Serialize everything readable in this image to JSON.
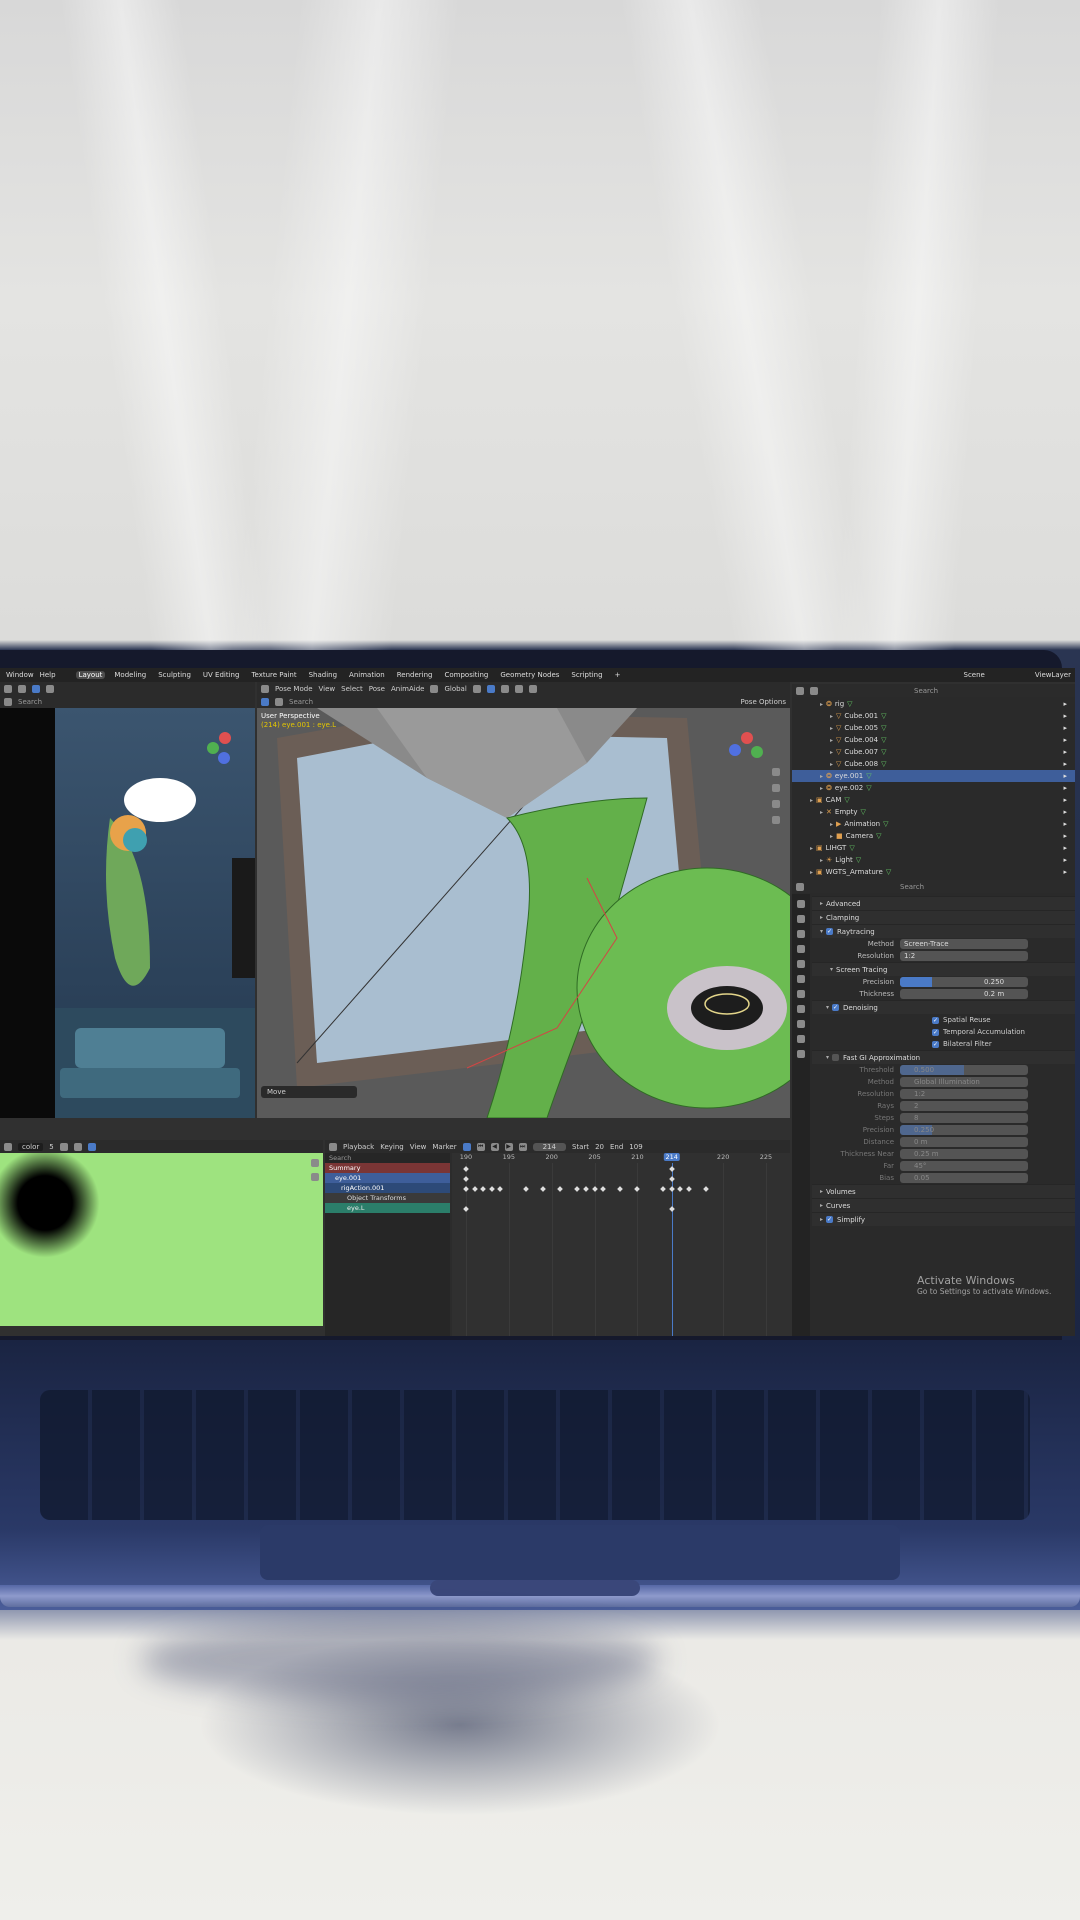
{
  "menu": {
    "items": [
      "Window",
      "Help"
    ],
    "workspaces": [
      "Layout",
      "Modeling",
      "Sculpting",
      "UV Editing",
      "Texture Paint",
      "Shading",
      "Animation",
      "Rendering",
      "Compositing",
      "Geometry Nodes",
      "Scripting",
      "+"
    ],
    "active_workspace": "Layout",
    "scene_label": "Scene",
    "viewlayer_label": "ViewLayer"
  },
  "left_view": {
    "search_placeholder": "Search"
  },
  "viewport": {
    "mode": "Pose Mode",
    "menu": [
      "View",
      "Select",
      "Pose",
      "AnimAide"
    ],
    "orientation": "Global",
    "search_placeholder": "Search",
    "pose_options": "Pose Options",
    "view_title": "User Perspective",
    "view_subtitle": "(214) eye.001 : eye.L",
    "last_op": "Move"
  },
  "outliner": {
    "search_placeholder": "Search",
    "rows": [
      {
        "label": "rig",
        "indent": 2,
        "type": "armature",
        "selected": false
      },
      {
        "label": "Cube.001",
        "indent": 3,
        "type": "mesh",
        "selected": false
      },
      {
        "label": "Cube.005",
        "indent": 3,
        "type": "mesh",
        "selected": false
      },
      {
        "label": "Cube.004",
        "indent": 3,
        "type": "mesh",
        "selected": false
      },
      {
        "label": "Cube.007",
        "indent": 3,
        "type": "mesh",
        "selected": false
      },
      {
        "label": "Cube.008",
        "indent": 3,
        "type": "mesh",
        "selected": false
      },
      {
        "label": "eye.001",
        "indent": 2,
        "type": "armature",
        "selected": true
      },
      {
        "label": "eye.002",
        "indent": 2,
        "type": "armature",
        "selected": false
      },
      {
        "label": "CAM",
        "indent": 1,
        "type": "collection",
        "selected": false
      },
      {
        "label": "Empty",
        "indent": 2,
        "type": "empty",
        "selected": false
      },
      {
        "label": "Animation",
        "indent": 3,
        "type": "action",
        "selected": false
      },
      {
        "label": "Camera",
        "indent": 3,
        "type": "camera",
        "selected": false
      },
      {
        "label": "LIHGT",
        "indent": 1,
        "type": "collection",
        "selected": false
      },
      {
        "label": "Light",
        "indent": 2,
        "type": "light",
        "selected": false
      },
      {
        "label": "WGTS_Armature",
        "indent": 1,
        "type": "collection",
        "selected": false
      }
    ]
  },
  "properties": {
    "search_placeholder": "Search",
    "advanced": "Advanced",
    "clamping": "Clamping",
    "raytracing": "Raytracing",
    "method_label": "Method",
    "method_value": "Screen-Trace",
    "resolution_label": "Resolution",
    "resolution_value": "1:2",
    "screen_tracing": "Screen Tracing",
    "precision_label": "Precision",
    "precision_value": "0.250",
    "precision_fill": 0.25,
    "thickness_label": "Thickness",
    "thickness_value": "0.2 m",
    "denoising": "Denoising",
    "spatial_reuse": "Spatial Reuse",
    "temporal_accumulation": "Temporal Accumulation",
    "bilateral_filter": "Bilateral Filter",
    "fast_gi": "Fast GI Approximation",
    "gi_rows": [
      {
        "label": "Threshold",
        "value": "0.500",
        "fill": 0.5
      },
      {
        "label": "Method",
        "value": "Global Illumination",
        "fill": 0
      },
      {
        "label": "Resolution",
        "value": "1:2",
        "fill": 0
      },
      {
        "label": "Rays",
        "value": "2",
        "fill": 0
      },
      {
        "label": "Steps",
        "value": "8",
        "fill": 0
      },
      {
        "label": "Precision",
        "value": "0.250",
        "fill": 0.25
      },
      {
        "label": "Distance",
        "value": "0 m",
        "fill": 0
      },
      {
        "label": "Thickness Near",
        "value": "0.25 m",
        "fill": 0
      },
      {
        "label": "Far",
        "value": "45°",
        "fill": 0
      },
      {
        "label": "Bias",
        "value": "0.05",
        "fill": 0
      }
    ],
    "volumes": "Volumes",
    "curves": "Curves",
    "simplify": "Simplify",
    "watermark_title": "Activate Windows",
    "watermark_sub": "Go to Settings to activate Windows."
  },
  "image_editor": {
    "image_name": "color",
    "users": "5"
  },
  "timeline": {
    "menu": [
      "Playback",
      "Keying",
      "View",
      "Marker"
    ],
    "current_frame": "214",
    "start_label": "Start",
    "start_value": "20",
    "end_label": "End",
    "end_value": "109",
    "search_placeholder": "Search",
    "ticks": [
      "190",
      "195",
      "200",
      "205",
      "210",
      "214",
      "220",
      "225"
    ],
    "channels": [
      "Summary",
      "eye.001",
      "rigAction.001",
      "Object Transforms",
      "eye.L"
    ]
  },
  "colors": {
    "accent": "#4a7ac7",
    "green_image": "#9ee37f",
    "selection": "#3e5e9a"
  }
}
